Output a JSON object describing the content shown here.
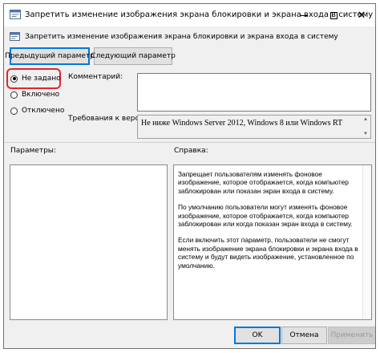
{
  "window": {
    "title": "Запретить изменение изображения экрана блокировки и экрана входа в систему",
    "controls": {
      "minimize": "minimize-icon",
      "maximize": "maximize-icon",
      "close": "✕"
    }
  },
  "policy": {
    "name": "Запретить изменение изображения экрана блокировки и экрана входа в систему"
  },
  "nav": {
    "prev_label": "Предыдущий параметр",
    "next_label": "Следующий параметр"
  },
  "state": {
    "options": [
      {
        "label": "Не задано",
        "checked": true
      },
      {
        "label": "Включено",
        "checked": false
      },
      {
        "label": "Отключено",
        "checked": false
      }
    ]
  },
  "comment": {
    "label": "Комментарий:",
    "value": ""
  },
  "requirements": {
    "label": "Требования к версии:",
    "value": "Не ниже Windows Server 2012, Windows 8 или Windows RT"
  },
  "params": {
    "label": "Параметры:"
  },
  "help": {
    "label": "Справка:",
    "paragraphs": [
      "Запрещает пользователям изменять фоновое изображение, которое отображается, когда компьютер заблокирован или показан экран входа в систему.",
      "По умолчанию пользователи могут изменять фоновое изображение, которое отображается, когда компьютер заблокирован или когда показан экран входа в систему.",
      "Если включить этот параметр, пользователи не смогут менять изображение экрана блокировки и экрана входа в систему и будут видеть изображение, установленное по умолчанию."
    ]
  },
  "footer": {
    "ok_label": "OK",
    "cancel_label": "Отмена",
    "apply_label": "Применить"
  },
  "colors": {
    "accent": "#0078d7",
    "highlight": "#e0282c"
  }
}
